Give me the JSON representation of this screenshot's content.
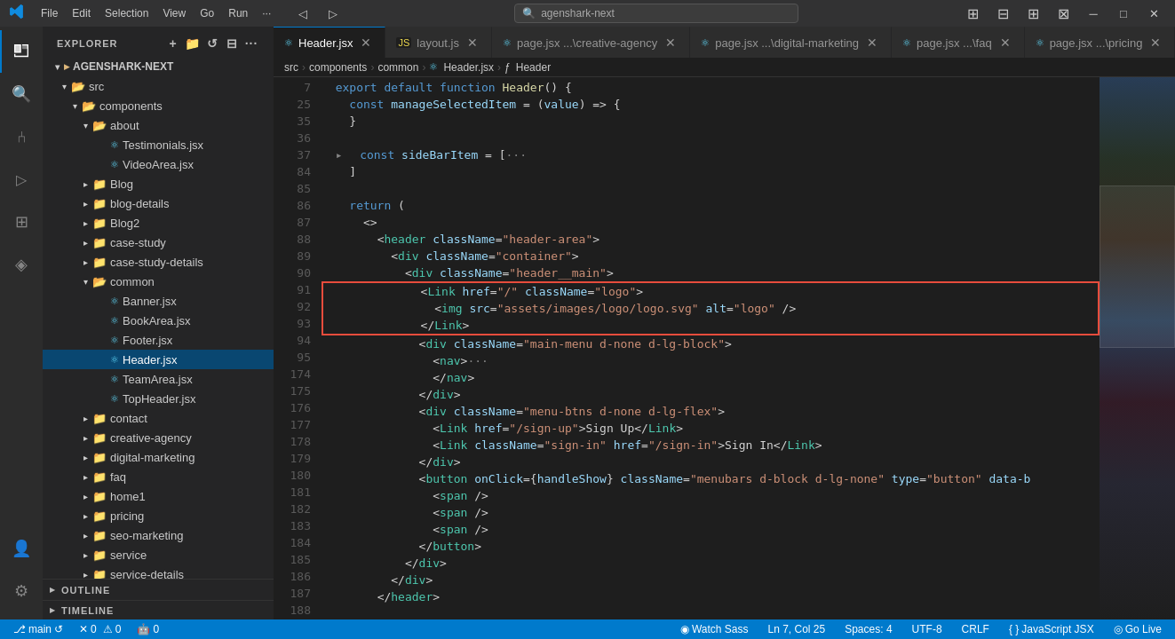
{
  "titleBar": {
    "menus": [
      "File",
      "Edit",
      "Selection",
      "View",
      "Go",
      "Run"
    ],
    "more": "···",
    "search": "agenshark-next",
    "search_placeholder": "agenshark-next"
  },
  "tabs": [
    {
      "label": "Header.jsx",
      "type": "jsx",
      "active": true,
      "modified": false,
      "icon": "⚛"
    },
    {
      "label": "layout.js",
      "type": "js",
      "active": false,
      "modified": false,
      "icon": "JS"
    },
    {
      "label": "page.jsx ...\\creative-agency",
      "type": "jsx",
      "active": false,
      "modified": false,
      "icon": "⚛"
    },
    {
      "label": "page.jsx ...\\digital-marketing",
      "type": "jsx",
      "active": false,
      "modified": false,
      "icon": "⚛"
    },
    {
      "label": "page.jsx ...\\faq",
      "type": "jsx",
      "active": false,
      "modified": false,
      "icon": "⚛"
    },
    {
      "label": "page.jsx ...\\pricing",
      "type": "jsx",
      "active": false,
      "modified": false,
      "icon": "⚛"
    }
  ],
  "breadcrumb": {
    "items": [
      "src",
      "components",
      "common",
      "Header.jsx",
      "Header"
    ]
  },
  "explorer": {
    "title": "EXPLORER",
    "root": "AGENSHARK-NEXT",
    "tree": [
      {
        "level": 1,
        "type": "folder",
        "label": "src",
        "open": true
      },
      {
        "level": 2,
        "type": "folder",
        "label": "components",
        "open": true
      },
      {
        "level": 3,
        "type": "folder",
        "label": "about",
        "open": true
      },
      {
        "level": 4,
        "type": "file-jsx",
        "label": "Testimonials.jsx"
      },
      {
        "level": 4,
        "type": "file-jsx",
        "label": "VideoArea.jsx"
      },
      {
        "level": 3,
        "type": "folder",
        "label": "Blog",
        "open": false
      },
      {
        "level": 3,
        "type": "folder",
        "label": "blog-details",
        "open": false
      },
      {
        "level": 3,
        "type": "folder",
        "label": "Blog2",
        "open": false
      },
      {
        "level": 3,
        "type": "folder",
        "label": "case-study",
        "open": false
      },
      {
        "level": 3,
        "type": "folder",
        "label": "case-study-details",
        "open": false
      },
      {
        "level": 3,
        "type": "folder",
        "label": "common",
        "open": true
      },
      {
        "level": 4,
        "type": "file-jsx",
        "label": "Banner.jsx"
      },
      {
        "level": 4,
        "type": "file-jsx",
        "label": "BookArea.jsx"
      },
      {
        "level": 4,
        "type": "file-jsx",
        "label": "Footer.jsx"
      },
      {
        "level": 4,
        "type": "file-jsx",
        "label": "Header.jsx",
        "active": true
      },
      {
        "level": 4,
        "type": "file-jsx",
        "label": "TeamArea.jsx"
      },
      {
        "level": 4,
        "type": "file-jsx",
        "label": "TopHeader.jsx"
      },
      {
        "level": 3,
        "type": "folder",
        "label": "contact",
        "open": false
      },
      {
        "level": 3,
        "type": "folder",
        "label": "creative-agency",
        "open": false
      },
      {
        "level": 3,
        "type": "folder",
        "label": "digital-marketing",
        "open": false
      },
      {
        "level": 3,
        "type": "folder",
        "label": "faq",
        "open": false
      },
      {
        "level": 3,
        "type": "folder",
        "label": "home1",
        "open": false
      },
      {
        "level": 3,
        "type": "folder",
        "label": "pricing",
        "open": false
      },
      {
        "level": 3,
        "type": "folder",
        "label": "seo-marketing",
        "open": false
      },
      {
        "level": 3,
        "type": "folder",
        "label": "service",
        "open": false
      },
      {
        "level": 3,
        "type": "folder",
        "label": "service-details",
        "open": false
      }
    ],
    "outline": "OUTLINE",
    "timeline": "TIMELINE"
  },
  "code": {
    "lines": [
      {
        "num": 7,
        "content": "  export default function Header() {"
      },
      {
        "num": 25,
        "content": "    const manageSelectedItem = (value) => {"
      },
      {
        "num": 35,
        "content": "    }"
      },
      {
        "num": 36,
        "content": ""
      },
      {
        "num": 37,
        "content": "    const sideBarItem = [···"
      },
      {
        "num": 84,
        "content": "    ]"
      },
      {
        "num": 85,
        "content": ""
      },
      {
        "num": 86,
        "content": "    return ("
      },
      {
        "num": 87,
        "content": "      <>"
      },
      {
        "num": 88,
        "content": "        <header className=\"header-area\">"
      },
      {
        "num": 89,
        "content": "          <div className=\"container\">"
      },
      {
        "num": 90,
        "content": "            <div className=\"header__main\">"
      },
      {
        "num": 91,
        "content": "              <Link href=\"/\" className=\"logo\">"
      },
      {
        "num": 92,
        "content": "                <img src=\"assets/images/logo/logo.svg\" alt=\"logo\" />"
      },
      {
        "num": 93,
        "content": "              </Link>"
      },
      {
        "num": 94,
        "content": "              <div className=\"main-menu d-none d-lg-block\">"
      },
      {
        "num": 95,
        "content": "                <nav>···"
      },
      {
        "num": 174,
        "content": "                </nav>"
      },
      {
        "num": 175,
        "content": "              </div>"
      },
      {
        "num": 176,
        "content": "              <div className=\"menu-btns d-none d-lg-flex\">"
      },
      {
        "num": 177,
        "content": "                <Link href=\"/sign-up\">Sign Up</Link>"
      },
      {
        "num": 178,
        "content": "                <Link className=\"sign-in\" href=\"/sign-in\">Sign In</Link>"
      },
      {
        "num": 179,
        "content": "              </div>"
      },
      {
        "num": 180,
        "content": "              <button onClick={handleShow} className=\"menubars d-block d-lg-none\" type=\"button\" data-b"
      },
      {
        "num": 181,
        "content": "                <span />"
      },
      {
        "num": 182,
        "content": "                <span />"
      },
      {
        "num": 183,
        "content": "                <span />"
      },
      {
        "num": 184,
        "content": "              </button>"
      },
      {
        "num": 185,
        "content": "            </div>"
      },
      {
        "num": 186,
        "content": "          </div>"
      },
      {
        "num": 187,
        "content": "        </header>"
      },
      {
        "num": 188,
        "content": ""
      }
    ]
  },
  "statusBar": {
    "branch": "main",
    "sync": "↺",
    "errors": "0",
    "warnings": "0",
    "branch_icon": "⎇",
    "ln": "Ln 7, Col 25",
    "spaces": "Spaces: 4",
    "encoding": "UTF-8",
    "lineending": "CRLF",
    "language": "JavaScript JSX",
    "watch": "◉ Watch Sass",
    "golive": "◎ Go Live"
  }
}
